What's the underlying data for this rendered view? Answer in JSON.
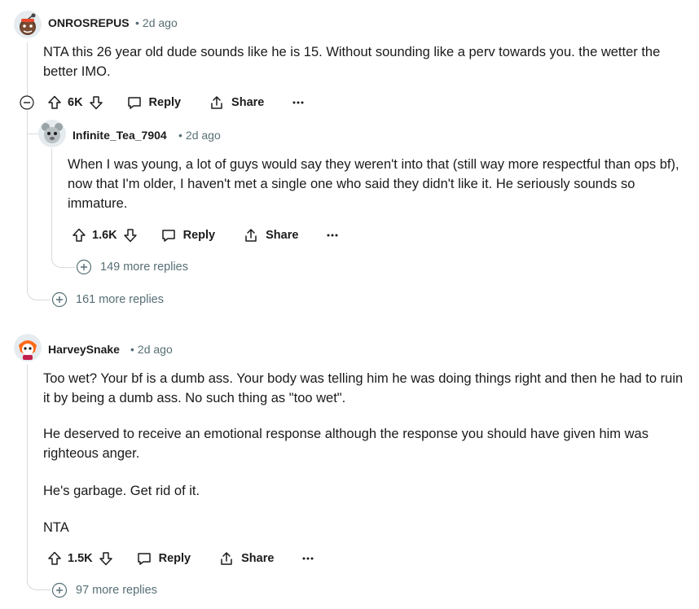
{
  "comments": [
    {
      "username": "ONROSREPUS",
      "time": "2d ago",
      "paragraphs": [
        "NTA this 26 year old dude sounds like he is 15. Without sounding like a perv towards you. the wetter the better IMO."
      ],
      "votes": "6K",
      "reply_label": "Reply",
      "share_label": "Share",
      "more_replies": "161 more replies",
      "reply": {
        "username": "Infinite_Tea_7904",
        "time": "2d ago",
        "paragraphs": [
          "When I was young, a lot of guys would say they weren't into that (still way more respectful than ops bf), now that I'm older, I haven't met a single one who said they didn't like it. He seriously sounds so immature."
        ],
        "votes": "1.6K",
        "reply_label": "Reply",
        "share_label": "Share",
        "more_replies": "149 more replies"
      }
    },
    {
      "username": "HarveySnake",
      "time": "2d ago",
      "paragraphs": [
        "Too wet? Your bf is a dumb ass. Your body was telling him he was doing things right and then he had to ruin it by being a dumb ass. No such thing as \"too wet\".",
        "He deserved to receive an emotional response although the response you should have given him was righteous anger.",
        "He's garbage. Get rid of it.",
        "NTA"
      ],
      "votes": "1.5K",
      "reply_label": "Reply",
      "share_label": "Share",
      "more_replies": "97 more replies"
    }
  ],
  "colors": {
    "text": "#1a1a1b",
    "meta": "#576f76",
    "thread_line": "#d6dadc",
    "avatar_bg": "#e5ebee"
  },
  "icons": [
    "upvote-icon",
    "downvote-icon",
    "comment-icon",
    "share-icon",
    "overflow-icon",
    "collapse-icon",
    "expand-icon"
  ]
}
